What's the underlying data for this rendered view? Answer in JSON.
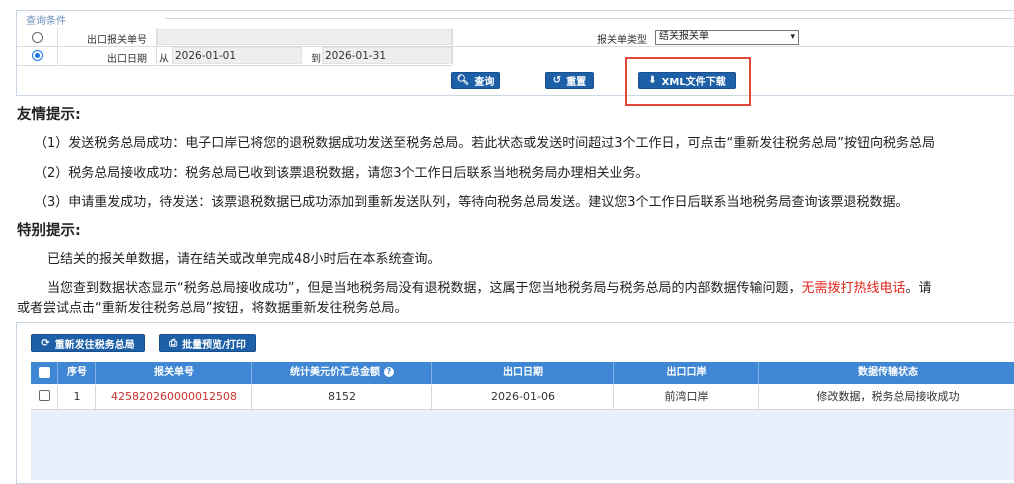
{
  "query": {
    "legend": "查询条件",
    "row1": {
      "label": "出口报关单号",
      "type_label": "报关单类型",
      "type_value": "结关报关单"
    },
    "row2": {
      "label": "出口日期",
      "from_label": "从",
      "from_value": "2026-01-01",
      "to_label": "到",
      "to_value": "2026-01-31"
    },
    "buttons": {
      "search": "查询",
      "reset": "重置",
      "xml": "XML文件下载"
    }
  },
  "tips": {
    "heading": "友情提示:",
    "items": [
      "（1）发送税务总局成功：电子口岸已将您的退税数据成功发送至税务总局。若此状态或发送时间超过3个工作日，可点击“重新发往税务总局”按钮向税务总局",
      "（2）税务总局接收成功：税务总局已收到该票退税数据，请您3个工作日后联系当地税务局办理相关业务。",
      "（3）申请重发成功，待发送：该票退税数据已成功添加到重新发送队列，等待向税务总局发送。建议您3个工作日后联系当地税务局查询该票退税数据。"
    ]
  },
  "special": {
    "heading": "特别提示:",
    "line1": "已结关的报关单数据，请在结关或改单完成48小时后在本系统查询。",
    "line2_a": "当您查到数据状态显示“税务总局接收成功”，但是当地税务局没有退税数据，这属于您当地税务局与税务总局的内部数据传输问题，",
    "line2_red": "无需拨打热线电话",
    "line2_b": "。请",
    "line3": "或者尝试点击“重新发往税务总局”按钮，将数据重新发往税务总局。"
  },
  "grid": {
    "toolbar": {
      "resend": "重新发往税务总局",
      "print": "批量预览/打印"
    },
    "columns": [
      "序号",
      "报关单号",
      "统计美元价汇总金额",
      "出口日期",
      "出口口岸",
      "数据传输状态"
    ],
    "rows": [
      {
        "index": "1",
        "declaration_no": "425820260000012508",
        "usd_total": "8152",
        "export_date": "2026-01-06",
        "port": "前湾口岸",
        "status": "修改数据，税务总局接收成功"
      }
    ]
  },
  "colors": {
    "button_blue": "#1e60a8",
    "header_blue": "#3f86d4",
    "highlight_red": "#e0463a",
    "warning_red": "#e0251b"
  },
  "icons": [
    "search-icon",
    "reset-icon",
    "download-icon",
    "refresh-icon",
    "print-icon",
    "help-icon"
  ]
}
